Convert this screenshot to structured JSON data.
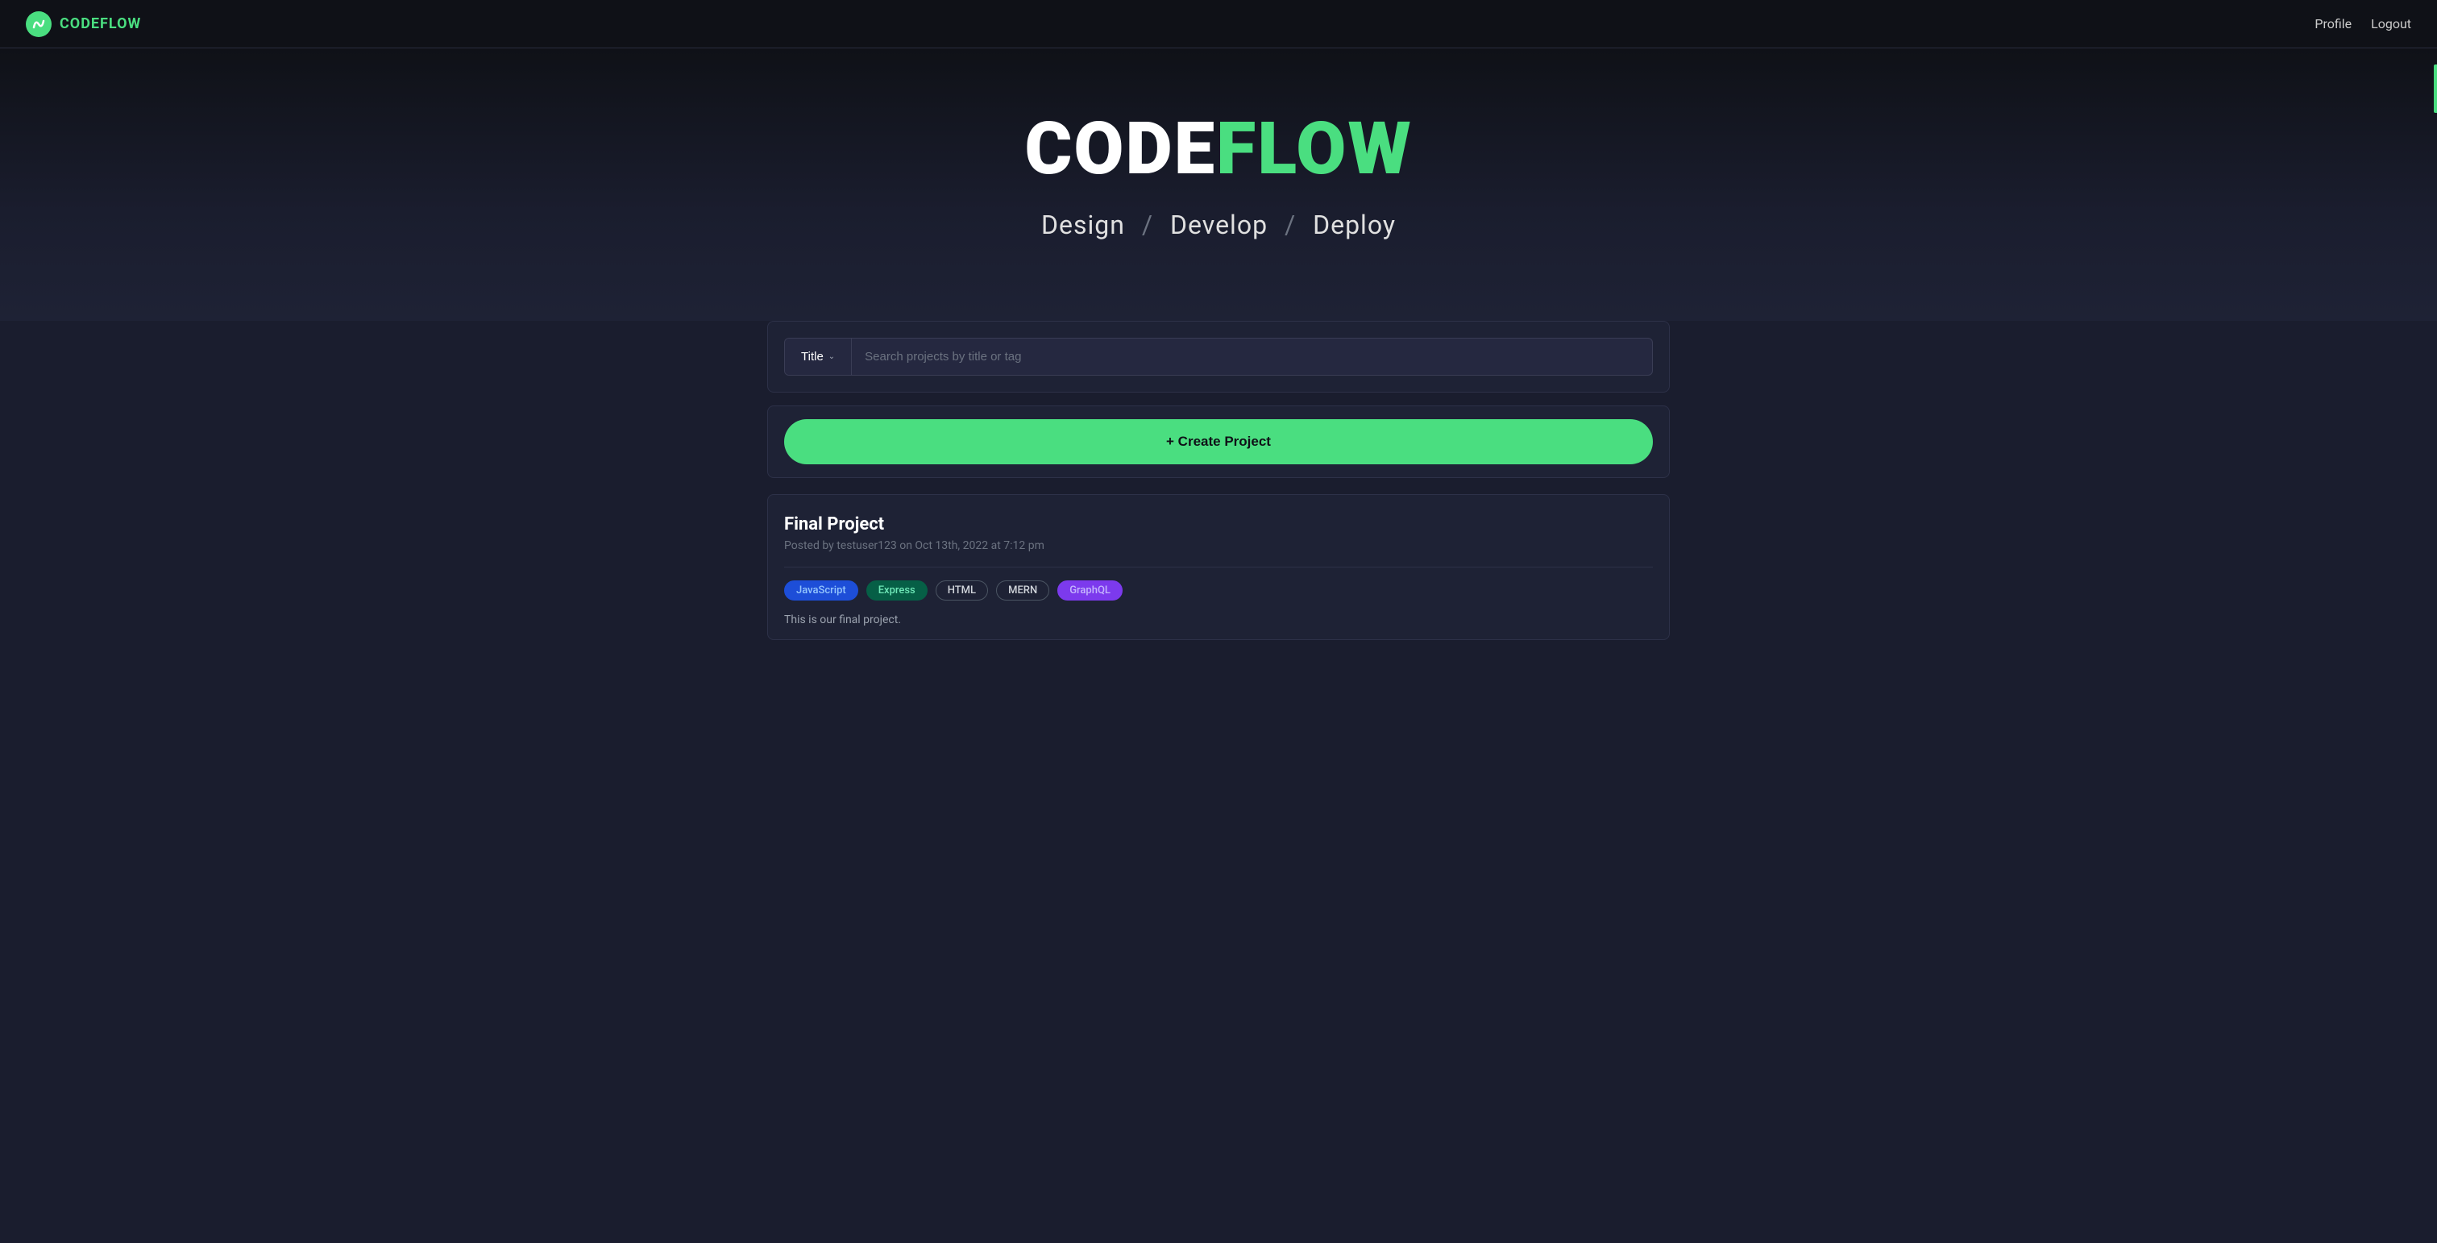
{
  "navbar": {
    "brand_code": "CODE",
    "brand_flow": "FLOW",
    "nav_items": [
      {
        "label": "Profile",
        "href": "#"
      },
      {
        "label": "Logout",
        "href": "#"
      }
    ]
  },
  "hero": {
    "title_code": "CODE",
    "title_flow": "FLOW",
    "subtitle": "Design  /  Develop  /  Deploy",
    "subtitle_parts": [
      "Design",
      "/",
      "Develop",
      "/",
      "Deploy"
    ]
  },
  "search": {
    "filter_label": "Title",
    "chevron": "∨",
    "placeholder": "Search projects by title or tag"
  },
  "create_project": {
    "label": "+ Create Project"
  },
  "projects": [
    {
      "title": "Final Project",
      "meta": "Posted by testuser123 on Oct 13th, 2022 at 7:12 pm",
      "tags": [
        {
          "name": "JavaScript",
          "style": "javascript"
        },
        {
          "name": "Express",
          "style": "express"
        },
        {
          "name": "HTML",
          "style": "html"
        },
        {
          "name": "MERN",
          "style": "mern"
        },
        {
          "name": "GraphQL",
          "style": "graphql"
        }
      ],
      "description": "This is our final project."
    }
  ]
}
